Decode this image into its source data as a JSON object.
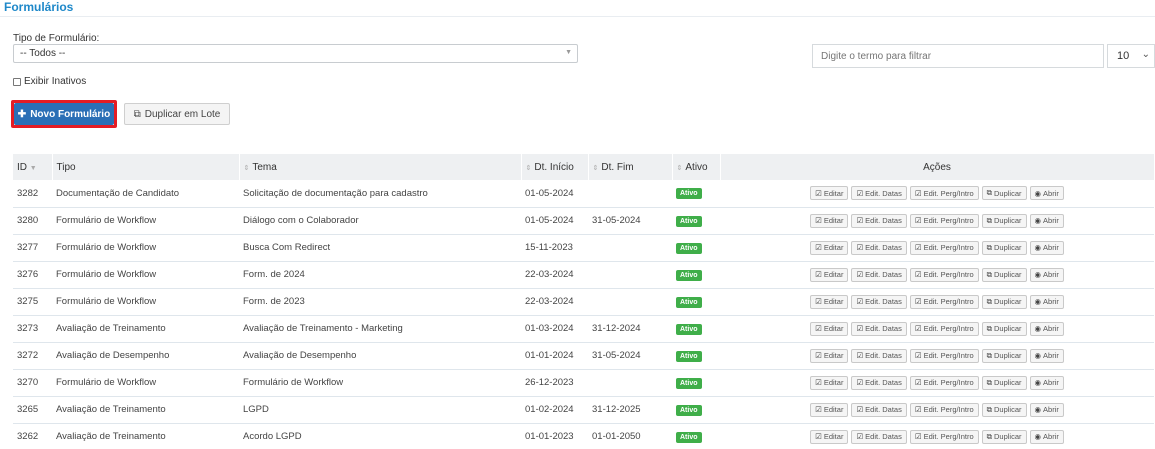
{
  "page": {
    "title": "Formulários"
  },
  "filters": {
    "type_label": "Tipo de Formulário:",
    "type_selected": "-- Todos --",
    "search_placeholder": "Digite o termo para filtrar",
    "page_size": "10",
    "show_inactive_label": "Exibir Inativos"
  },
  "toolbar": {
    "new_label": "Novo Formulário",
    "duplicate_batch_label": "Duplicar em Lote"
  },
  "table": {
    "headers": [
      "ID",
      "Tipo",
      "Tema",
      "Dt. Início",
      "Dt. Fim",
      "Ativo",
      "Ações"
    ],
    "action_labels": [
      "Editar",
      "Edit. Datas",
      "Edit. Perg/Intro",
      "Duplicar",
      "Abrir"
    ],
    "rows": [
      {
        "id": "3282",
        "tipo": "Documentação de Candidato",
        "tema": "Solicitação de documentação para cadastro",
        "inicio": "01-05-2024",
        "fim": "",
        "status": "Ativo"
      },
      {
        "id": "3280",
        "tipo": "Formulário de Workflow",
        "tema": "Diálogo com o Colaborador",
        "inicio": "01-05-2024",
        "fim": "31-05-2024",
        "status": "Ativo"
      },
      {
        "id": "3277",
        "tipo": "Formulário de Workflow",
        "tema": "Busca Com Redirect",
        "inicio": "15-11-2023",
        "fim": "",
        "status": "Ativo"
      },
      {
        "id": "3276",
        "tipo": "Formulário de Workflow",
        "tema": "Form. de 2024",
        "inicio": "22-03-2024",
        "fim": "",
        "status": "Ativo"
      },
      {
        "id": "3275",
        "tipo": "Formulário de Workflow",
        "tema": "Form. de 2023",
        "inicio": "22-03-2024",
        "fim": "",
        "status": "Ativo"
      },
      {
        "id": "3273",
        "tipo": "Avaliação de Treinamento",
        "tema": "Avaliação de Treinamento - Marketing",
        "inicio": "01-03-2024",
        "fim": "31-12-2024",
        "status": "Ativo"
      },
      {
        "id": "3272",
        "tipo": "Avaliação de Desempenho",
        "tema": "Avaliação de Desempenho",
        "inicio": "01-01-2024",
        "fim": "31-05-2024",
        "status": "Ativo"
      },
      {
        "id": "3270",
        "tipo": "Formulário de Workflow",
        "tema": "Formulário de Workflow",
        "inicio": "26-12-2023",
        "fim": "",
        "status": "Ativo"
      },
      {
        "id": "3265",
        "tipo": "Avaliação de Treinamento",
        "tema": "LGPD",
        "inicio": "01-02-2024",
        "fim": "31-12-2025",
        "status": "Ativo"
      },
      {
        "id": "3262",
        "tipo": "Avaliação de Treinamento",
        "tema": "Acordo LGPD",
        "inicio": "01-01-2023",
        "fim": "01-01-2050",
        "status": "Ativo"
      }
    ]
  },
  "colors": {
    "accent": "#1e88c9",
    "primary_button": "#2a6fb6",
    "highlight_border": "#e41c24",
    "status_active": "#3fae49"
  }
}
